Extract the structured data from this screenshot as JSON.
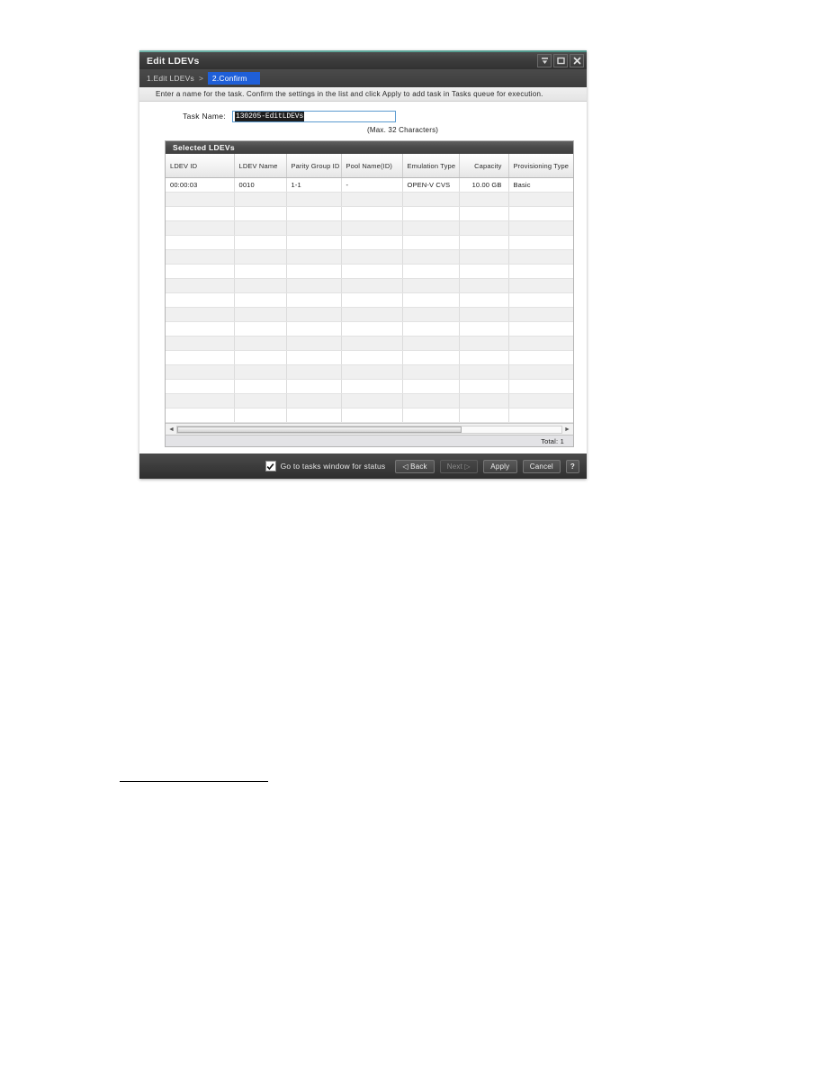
{
  "window": {
    "title": "Edit LDEVs",
    "buttons": [
      {
        "name": "collapse",
        "label": "collapse-icon"
      },
      {
        "name": "maximize",
        "label": "maximize-icon"
      },
      {
        "name": "close",
        "label": "close-icon"
      }
    ]
  },
  "breadcrumb": {
    "step1": "1.Edit LDEVs",
    "separator": ">",
    "step2": "2.Confirm"
  },
  "instruction": "Enter a name for the task. Confirm the settings in the list and click Apply to add task in Tasks queue for execution.",
  "task": {
    "label": "Task Name:",
    "value": "130205-EditLDEVs",
    "placeholder": "",
    "hint": "(Max. 32 Characters)"
  },
  "table": {
    "title": "Selected LDEVs",
    "columns": [
      {
        "label": "LDEV ID",
        "align": "left"
      },
      {
        "label": "LDEV Name",
        "align": "left"
      },
      {
        "label": "Parity Group ID",
        "align": "left"
      },
      {
        "label": "Pool Name(ID)",
        "align": "left"
      },
      {
        "label": "Emulation Type",
        "align": "left"
      },
      {
        "label": "Capacity",
        "align": "right"
      },
      {
        "label": "Provisioning Type",
        "align": "left"
      }
    ],
    "rows": [
      {
        "ldev_id": "00:00:03",
        "ldev_name": "0010",
        "parity_group_id": "1-1",
        "pool_name_id": "-",
        "emulation_type": "OPEN-V CVS",
        "capacity": "10.00 GB",
        "provisioning_type": "Basic"
      }
    ],
    "empty_row_count": 16,
    "total_label": "Total:",
    "total_value": "1"
  },
  "scrollbar": {
    "left_arrow": "◄",
    "right_arrow": "►"
  },
  "footer": {
    "checkbox_label": "Go to tasks window for status",
    "checkbox_checked": true,
    "back_label": "◁ Back",
    "next_label": "Next ▷",
    "next_disabled": true,
    "apply_label": "Apply",
    "cancel_label": "Cancel",
    "help_label": "?"
  },
  "colors": {
    "accent_top": "#5aa396",
    "crumb_active": "#1f5fd8",
    "input_border": "#5b9bd0",
    "selection_bg": "#1d1d1d"
  }
}
